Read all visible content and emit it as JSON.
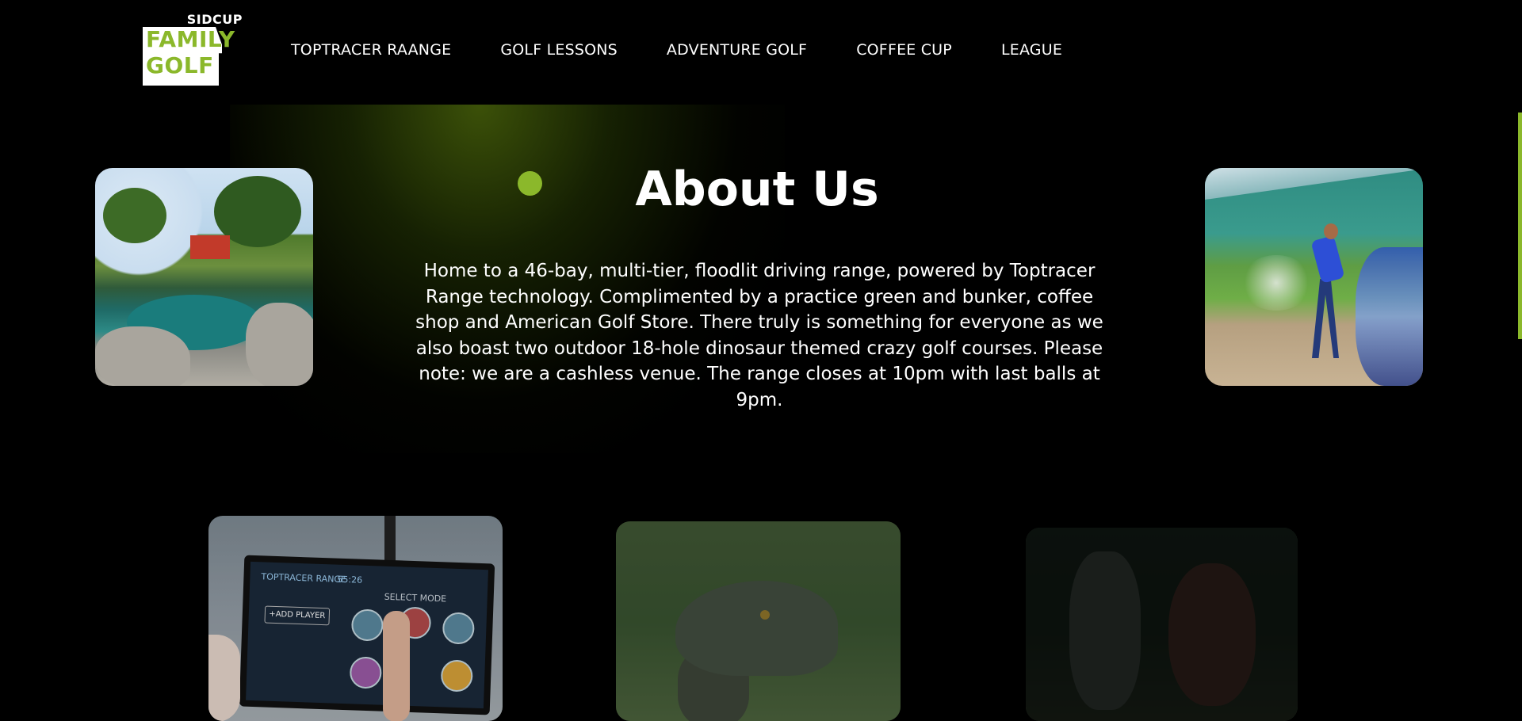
{
  "logo": {
    "top_text": "SIDCUP",
    "line1": "FAMILY",
    "line2": "GOLF"
  },
  "nav": {
    "items": [
      {
        "label": "TOPTRACER RAANGE"
      },
      {
        "label": "GOLF LESSONS"
      },
      {
        "label": "ADVENTURE GOLF"
      },
      {
        "label": "COFFEE CUP"
      },
      {
        "label": "LEAGUE"
      }
    ]
  },
  "about": {
    "title": "About Us",
    "body": "Home to a 46-bay, multi-tier, floodlit driving range, powered by Toptracer Range technology. Complimented by a practice green and bunker, coffee shop and American Golf Store. There truly is something for everyone as we also boast two outdoor 18-hole dinosaur themed crazy golf courses. Please note: we are a cashless venue. The range closes at 10pm with last balls at 9pm."
  },
  "cards": {
    "c1_screen_brand": "TOPTRACER RANGE",
    "c1_screen_time": "55:26",
    "c1_screen_mode": "SELECT MODE",
    "c1_screen_button": "+ADD PLAYER"
  },
  "colors": {
    "accent": "#8bb82b",
    "background": "#000000",
    "text": "#ffffff"
  }
}
